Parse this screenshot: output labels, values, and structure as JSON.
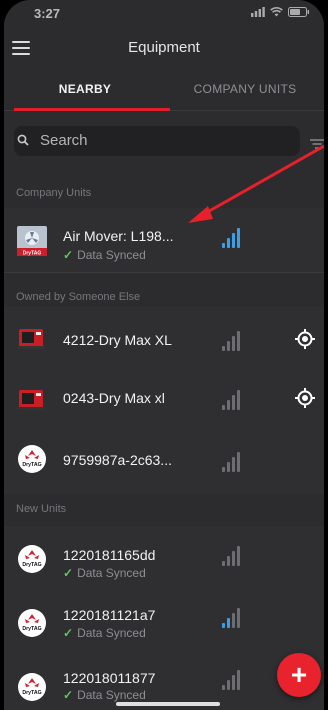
{
  "status_bar": {
    "time": "3:27"
  },
  "nav": {
    "title": "Equipment"
  },
  "tabs": [
    {
      "label": "NEARBY",
      "active": true
    },
    {
      "label": "COMPANY UNITS",
      "active": false
    }
  ],
  "search": {
    "placeholder": "Search"
  },
  "sections": {
    "company_units": "Company Units",
    "owned_by_other": "Owned by Someone Else",
    "new_units": "New Units"
  },
  "units": [
    {
      "title": "Air Mover: L198...",
      "status": "Data Synced",
      "thumb": "air-mover-icon",
      "signal_level": 4
    },
    {
      "title": "4212-Dry Max XL",
      "status": "",
      "thumb": "dehumidifier-icon",
      "signal_level": 0
    },
    {
      "title": "0243-Dry Max xl",
      "status": "",
      "thumb": "dehumidifier-icon",
      "signal_level": 0
    },
    {
      "title": "9759987a-2c63...",
      "status": "",
      "thumb": "drytag-logo",
      "signal_level": 0
    },
    {
      "title": "1220181165dd",
      "status": "Data Synced",
      "thumb": "drytag-logo",
      "signal_level": 0
    },
    {
      "title": "1220181121a7",
      "status": "Data Synced",
      "thumb": "drytag-logo",
      "signal_level": 2
    },
    {
      "title": "122018011877",
      "status": "Data Synced",
      "thumb": "drytag-logo",
      "signal_level": 0
    }
  ],
  "logo_text": "DryTAG",
  "colors": {
    "accent": "#e21d2c",
    "signal_active": "#3aa0e6",
    "signal_inactive": "#6e6e72",
    "synced": "#5ac85a"
  }
}
